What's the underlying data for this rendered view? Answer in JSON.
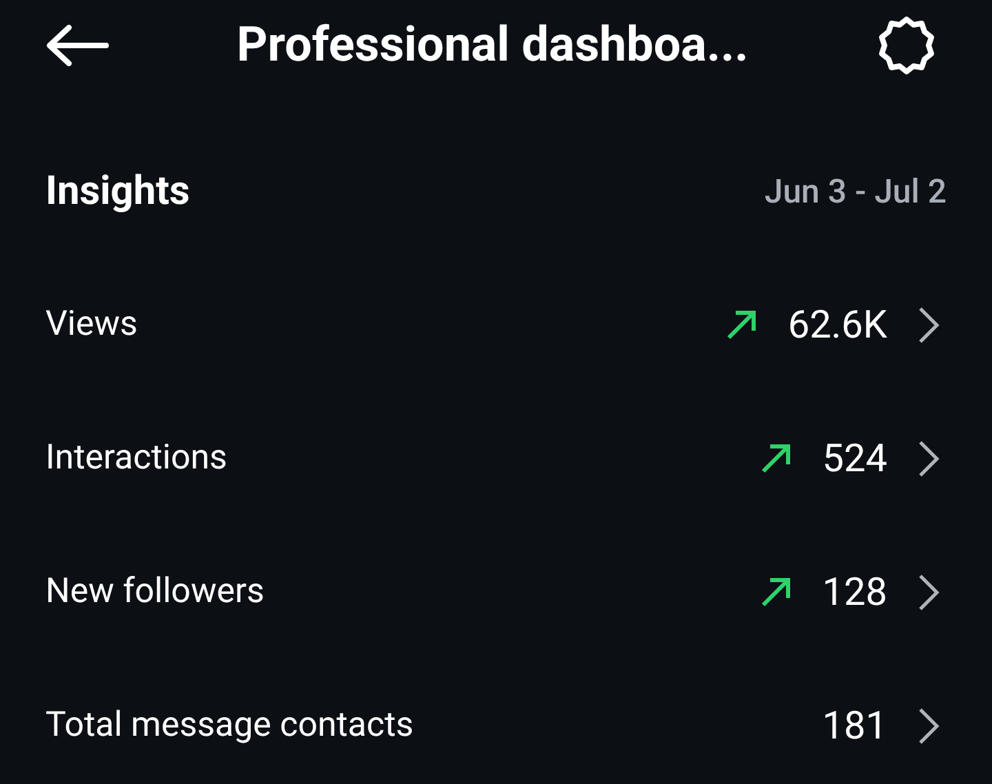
{
  "header": {
    "title": "Professional dashboa..."
  },
  "insights": {
    "title": "Insights",
    "date_range": "Jun 3 - Jul 2"
  },
  "metrics": [
    {
      "label": "Views",
      "value": "62.6K",
      "trend_up": true
    },
    {
      "label": "Interactions",
      "value": "524",
      "trend_up": true
    },
    {
      "label": "New followers",
      "value": "128",
      "trend_up": true
    },
    {
      "label": "Total message contacts",
      "value": "181",
      "trend_up": false
    }
  ]
}
